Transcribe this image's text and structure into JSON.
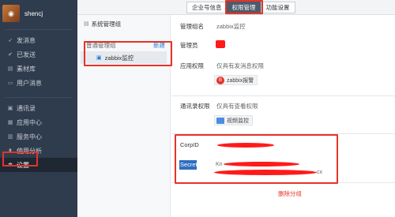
{
  "user": {
    "name": "shencj"
  },
  "sidebar": {
    "items": [
      {
        "label": "发消息",
        "icon": "send-icon"
      },
      {
        "label": "已发送",
        "icon": "sent-icon"
      },
      {
        "label": "素材库",
        "icon": "library-icon"
      },
      {
        "label": "用户消息",
        "icon": "message-icon"
      },
      {
        "label": "通讯录",
        "icon": "contacts-icon"
      },
      {
        "label": "应用中心",
        "icon": "apps-icon"
      },
      {
        "label": "服务中心",
        "icon": "service-icon"
      },
      {
        "label": "使用分析",
        "icon": "chart-icon"
      },
      {
        "label": "设置",
        "icon": "gear-icon",
        "active": true
      }
    ]
  },
  "tabs": [
    {
      "label": "企业号信息"
    },
    {
      "label": "权限管理",
      "active": true
    },
    {
      "label": "功能设置"
    }
  ],
  "groups": {
    "title": "系统管理组",
    "section_label": "普通管理组",
    "new_label": "新建",
    "items": [
      {
        "label": "zabbix监控"
      }
    ]
  },
  "detail": {
    "group_name_label": "管理组名",
    "group_name_value": "zabbix监控",
    "admin_label": "管理员",
    "app_perm_label": "应用权限",
    "app_perm_value": "仅具有发消息权限",
    "app_chip": "zabbix报警",
    "contacts_perm_label": "通讯录权限",
    "contacts_perm_value": "仅具有查看权限",
    "contacts_chip": "视频监控",
    "corpid_label": "CorpID",
    "secret_label": "Secret",
    "secret_prefix": "Kn",
    "secret_suffix": "cx",
    "delete_label": "删除分组"
  },
  "colors": {
    "sidebar_bg": "#2f3c4d",
    "highlight": "#e4342a",
    "link": "#2b7bd6"
  }
}
